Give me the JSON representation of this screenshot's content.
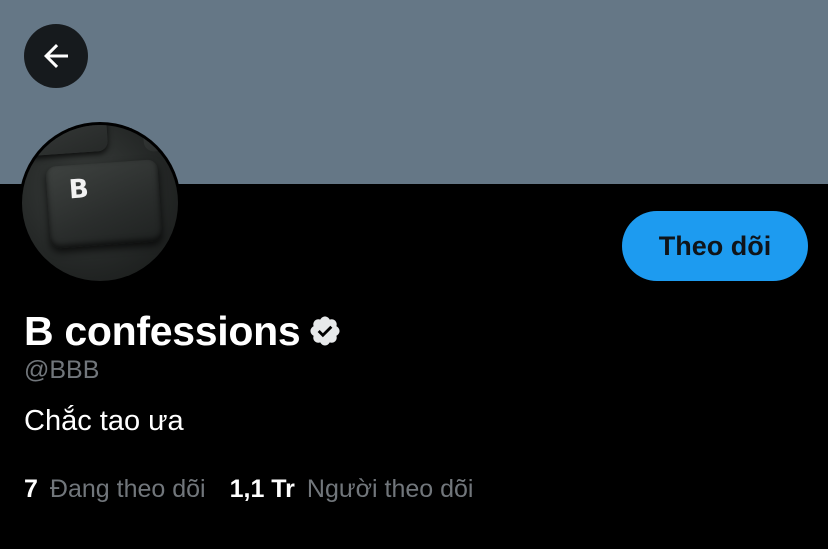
{
  "header": {
    "back_icon": "arrow-left-icon",
    "banner_color": "#657786"
  },
  "profile": {
    "avatar_key_letter": "B",
    "display_name": "B confessions",
    "verified_icon": "verified-badge-icon",
    "handle": "@BBB",
    "bio": "Chắc tao ưa"
  },
  "actions": {
    "follow_label": "Theo dõi",
    "follow_color": "#1d9bf0"
  },
  "stats": {
    "following_count": "7",
    "following_label": "Đang theo dõi",
    "followers_count": "1,1 Tr",
    "followers_label": "Người theo dõi"
  }
}
